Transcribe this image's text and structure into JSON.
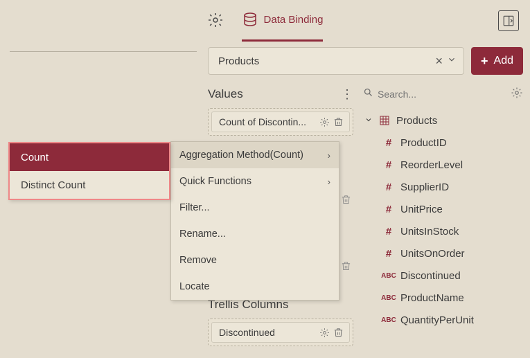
{
  "tabs": {
    "settings": "",
    "data_binding": "Data Binding"
  },
  "source": {
    "selected": "Products",
    "add_label": "Add"
  },
  "sections": {
    "values": "Values",
    "trellis_columns": "Trellis Columns"
  },
  "pills": {
    "value1": "Count of Discontin...",
    "trellis1": "Discontinued"
  },
  "search": {
    "placeholder": "Search..."
  },
  "tree": {
    "root": "Products",
    "fields": [
      {
        "type": "num",
        "label": "ProductID"
      },
      {
        "type": "num",
        "label": "ReorderLevel"
      },
      {
        "type": "num",
        "label": "SupplierID"
      },
      {
        "type": "num",
        "label": "UnitPrice"
      },
      {
        "type": "num",
        "label": "UnitsInStock"
      },
      {
        "type": "num",
        "label": "UnitsOnOrder"
      },
      {
        "type": "abc",
        "label": "Discontinued"
      },
      {
        "type": "abc",
        "label": "ProductName"
      },
      {
        "type": "abc",
        "label": "QuantityPerUnit"
      }
    ]
  },
  "context_menu": {
    "agg": "Aggregation Method(Count)",
    "quick": "Quick Functions",
    "filter": "Filter...",
    "rename": "Rename...",
    "remove": "Remove",
    "locate": "Locate"
  },
  "submenu": {
    "count": "Count",
    "distinct": "Distinct Count"
  }
}
